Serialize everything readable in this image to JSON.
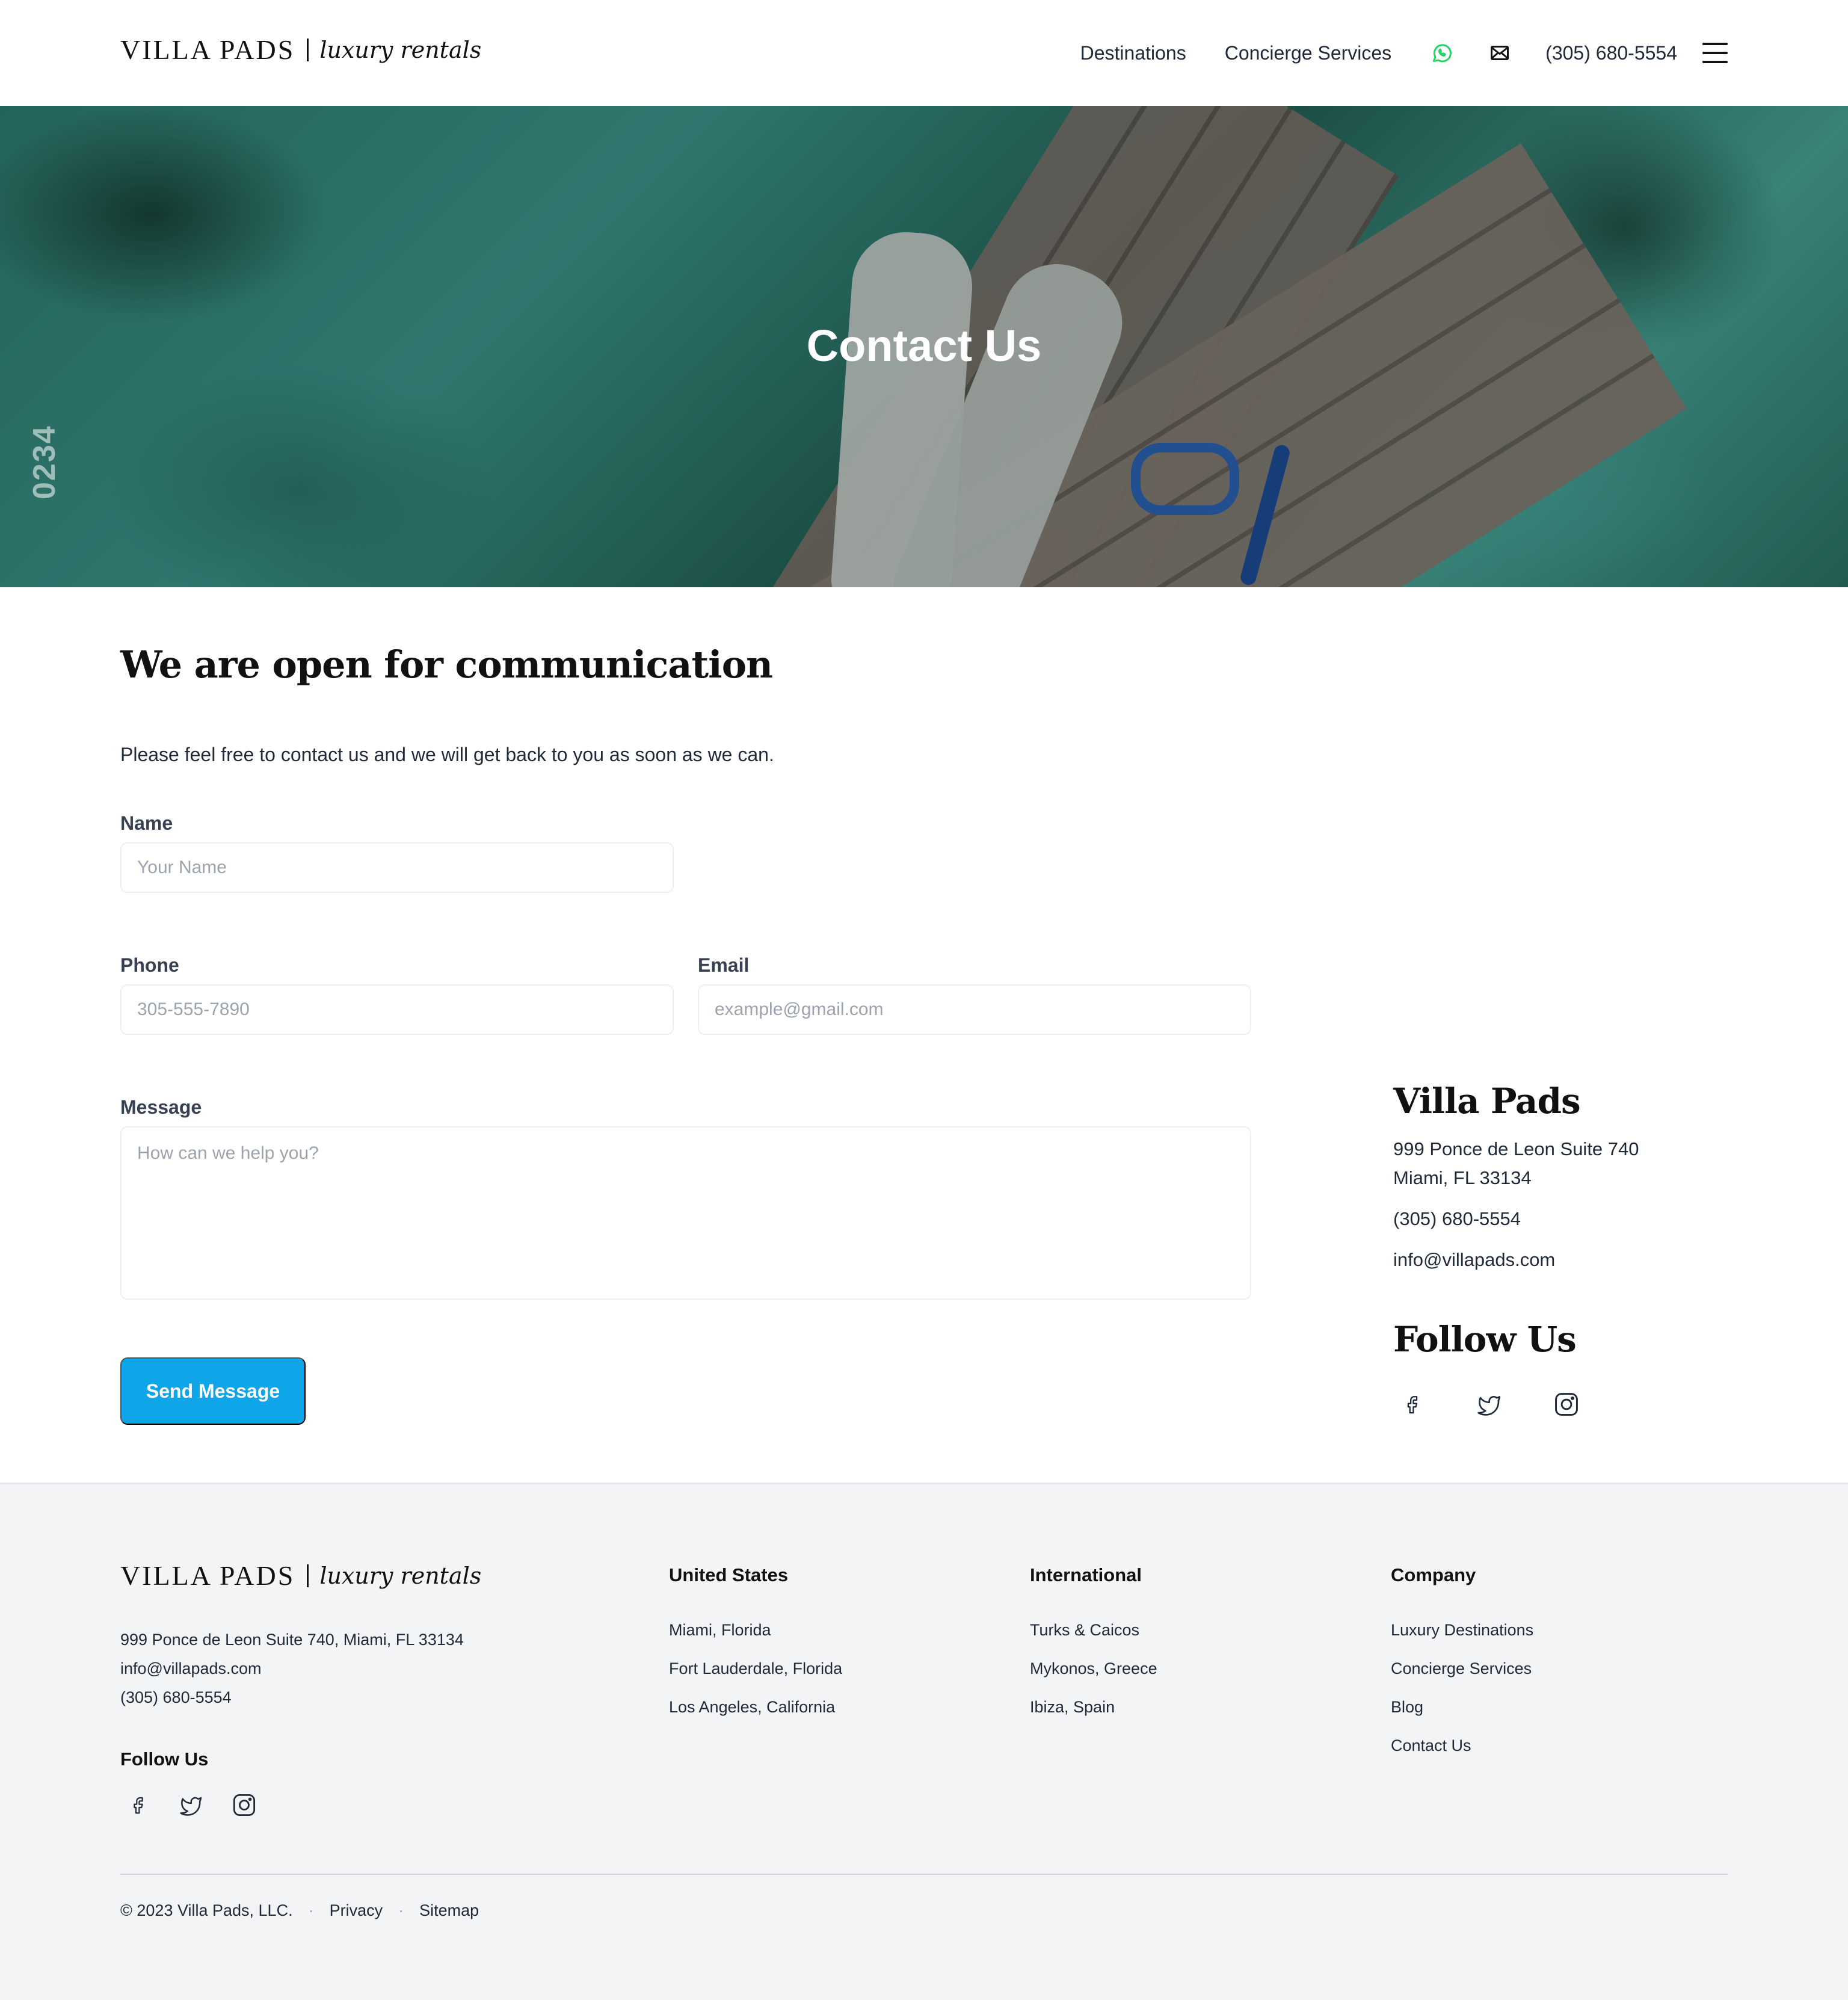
{
  "header": {
    "logo_main": "VILLA PADS",
    "logo_script": "luxury rentals",
    "nav": [
      "Destinations",
      "Concierge Services"
    ],
    "phone": "(305) 680-5554",
    "icons": {
      "whatsapp": "whatsapp-icon",
      "mail": "mail-icon",
      "menu": "hamburger-menu-icon"
    },
    "whatsapp_color": "#25D366"
  },
  "hero": {
    "title": "Contact Us",
    "watermark": "0234"
  },
  "main": {
    "heading": "We are open for communication",
    "intro": "Please feel free to contact us and we will get back to you as soon as we can.",
    "form": {
      "name_label": "Name",
      "name_placeholder": "Your Name",
      "phone_label": "Phone",
      "phone_placeholder": "305-555-7890",
      "email_label": "Email",
      "email_placeholder": "example@gmail.com",
      "message_label": "Message",
      "message_placeholder": "How can we help you?",
      "submit": "Send Message"
    },
    "accent_color": "#0EA5E9"
  },
  "sidebar": {
    "company": "Villa Pads",
    "address_line1": "999 Ponce de Leon Suite 740",
    "address_line2": "Miami, FL 33134",
    "phone": "(305) 680-5554",
    "email": "info@villapads.com",
    "follow_title": "Follow Us"
  },
  "footer": {
    "logo_main": "VILLA PADS",
    "logo_script": "luxury rentals",
    "address": "999 Ponce de Leon Suite 740, Miami, FL 33134",
    "email": "info@villapads.com",
    "phone": "(305) 680-5554",
    "follow_title": "Follow Us",
    "columns": [
      {
        "title": "United States",
        "links": [
          "Miami, Florida",
          "Fort Lauderdale, Florida",
          "Los Angeles, California"
        ]
      },
      {
        "title": "International",
        "links": [
          "Turks & Caicos",
          "Mykonos, Greece",
          "Ibiza, Spain"
        ]
      },
      {
        "title": "Company",
        "links": [
          "Luxury Destinations",
          "Concierge Services",
          "Blog",
          "Contact Us"
        ]
      }
    ],
    "copyright": "© 2023 Villa Pads, LLC.",
    "bottom_links": [
      "Privacy",
      "Sitemap"
    ],
    "separator": "·"
  }
}
